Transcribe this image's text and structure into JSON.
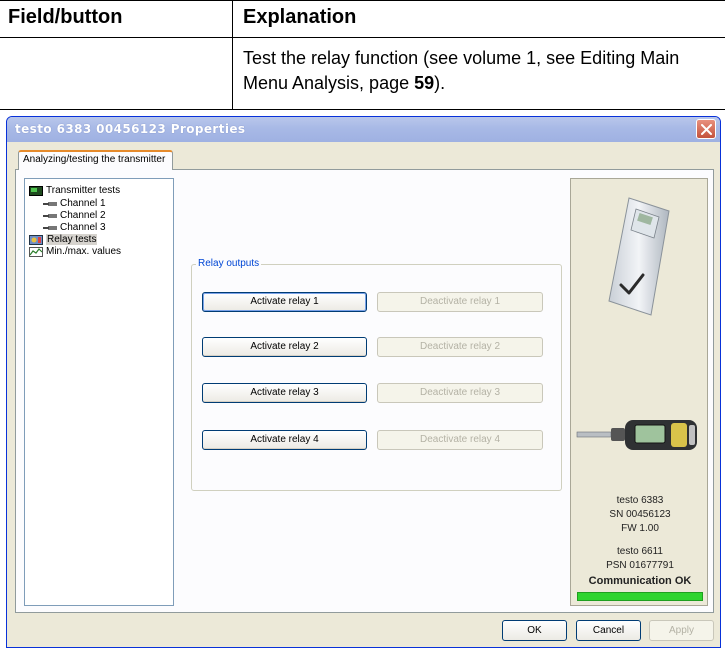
{
  "doc_table": {
    "header_field": "Field/button",
    "header_explanation": "Explanation",
    "row_text_before": "Test the relay function (see volume 1, see Editing Main Menu Analysis, page ",
    "row_page": "59",
    "row_text_after": ")."
  },
  "window": {
    "title": "testo 6383  00456123 Properties",
    "tab_label": "Analyzing/testing the transmitter"
  },
  "tree": {
    "items": [
      {
        "label": "Transmitter tests",
        "icon": "transmitter-icon"
      },
      {
        "label": "Channel 1",
        "icon": "channel-icon"
      },
      {
        "label": "Channel 2",
        "icon": "channel-icon"
      },
      {
        "label": "Channel 3",
        "icon": "channel-icon"
      },
      {
        "label": "Relay tests",
        "icon": "relay-icon"
      },
      {
        "label": "Min./max. values",
        "icon": "chart-icon"
      }
    ]
  },
  "relays": {
    "group_label": "Relay outputs",
    "activate": [
      "Activate relay 1",
      "Activate relay 2",
      "Activate relay 3",
      "Activate relay 4"
    ],
    "deactivate": [
      "Deactivate relay 1",
      "Deactivate relay 2",
      "Deactivate relay 3",
      "Deactivate relay 4"
    ]
  },
  "device": {
    "model": "testo 6383",
    "serial": "SN 00456123",
    "firmware": "FW 1.00",
    "probe_model": "testo 6611",
    "probe_serial": "PSN 01677791",
    "status": "Communication OK",
    "progress": 1.0
  },
  "buttons": {
    "ok": "OK",
    "cancel": "Cancel",
    "apply": "Apply"
  },
  "colors": {
    "progress": "#2fd42f",
    "group_label": "#0046d5"
  }
}
